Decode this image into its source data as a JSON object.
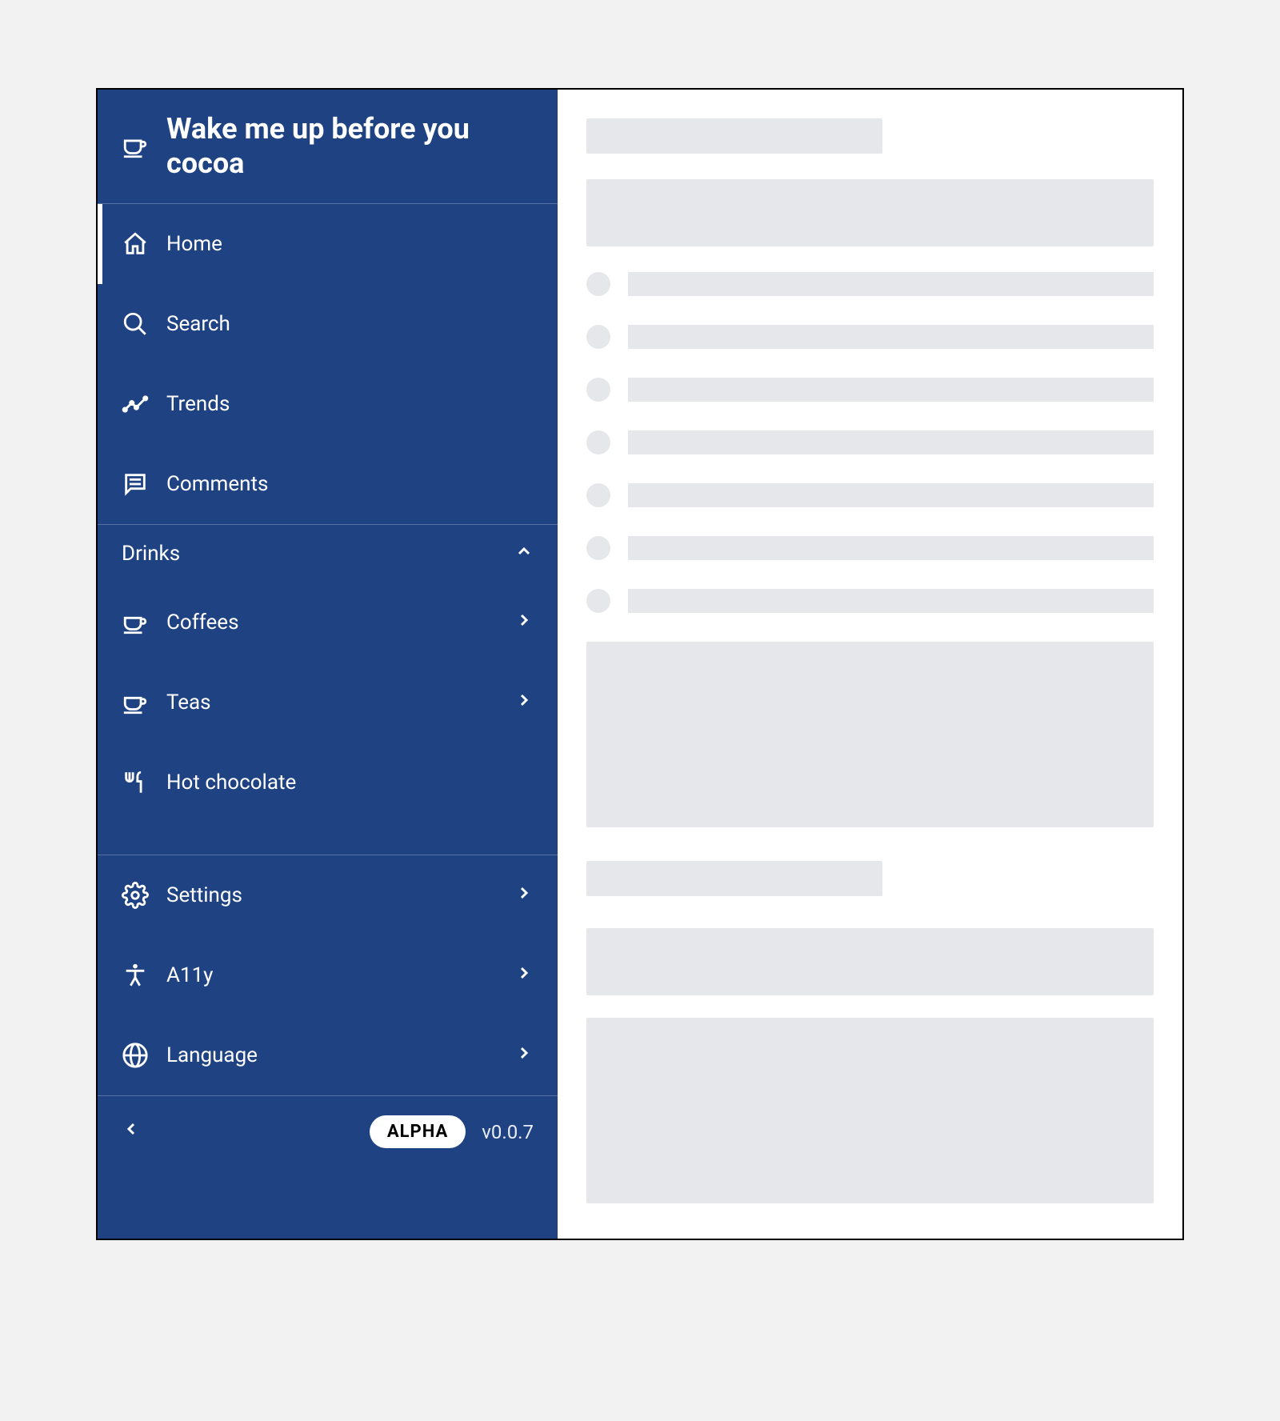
{
  "app": {
    "title": "Wake me up before you cocoa"
  },
  "nav": {
    "primary": [
      {
        "label": "Home",
        "selected": true
      },
      {
        "label": "Search"
      },
      {
        "label": "Trends"
      },
      {
        "label": "Comments"
      }
    ],
    "drinks_header": "Drinks",
    "drinks": [
      {
        "label": "Coffees",
        "has_children": true
      },
      {
        "label": "Teas",
        "has_children": true
      },
      {
        "label": "Hot chocolate",
        "has_children": false
      }
    ],
    "secondary": [
      {
        "label": "Settings",
        "has_children": true
      },
      {
        "label": "A11y",
        "has_children": true
      },
      {
        "label": "Language",
        "has_children": true
      }
    ]
  },
  "footer": {
    "badge": "ALPHA",
    "version": "v0.0.7"
  }
}
